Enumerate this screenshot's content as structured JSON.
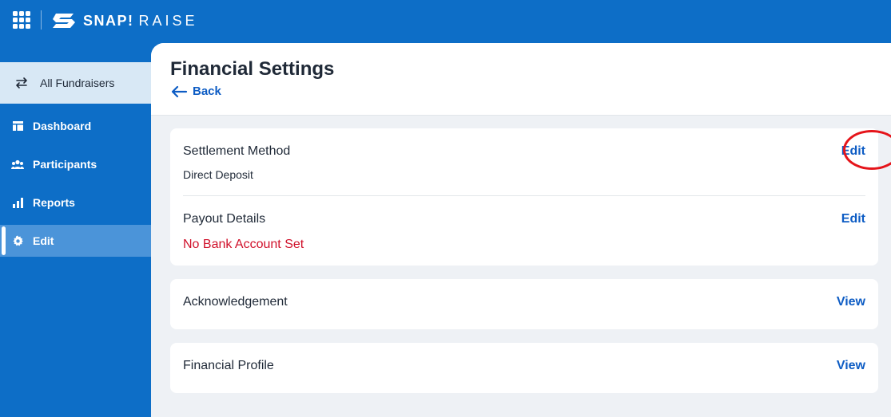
{
  "topbar": {
    "brand_primary": "SNAP!",
    "brand_secondary": "RAISE",
    "apps_icon": "apps-grid-icon",
    "logo_icon": "snap-logo-icon"
  },
  "sidebar": {
    "all_fundraisers": {
      "label": "All Fundraisers",
      "icon": "swap-arrows-icon"
    },
    "items": [
      {
        "label": "Dashboard",
        "icon": "dashboard-icon",
        "active": false
      },
      {
        "label": "Participants",
        "icon": "people-icon",
        "active": false
      },
      {
        "label": "Reports",
        "icon": "bar-chart-icon",
        "active": false
      },
      {
        "label": "Edit",
        "icon": "gear-icon",
        "active": true
      }
    ]
  },
  "main": {
    "title": "Financial Settings",
    "back_label": "Back",
    "settlement": {
      "label": "Settlement Method",
      "value": "Direct Deposit",
      "action": "Edit"
    },
    "payout": {
      "label": "Payout Details",
      "value": "No Bank Account Set",
      "action": "Edit"
    },
    "acknowledgement": {
      "label": "Acknowledgement",
      "action": "View"
    },
    "financial_profile": {
      "label": "Financial Profile",
      "action": "View"
    }
  },
  "colors": {
    "brand_blue": "#0d6ec7",
    "link_blue": "#0d5cc4",
    "error_red": "#d0102a",
    "highlight_red": "#e5141a"
  }
}
